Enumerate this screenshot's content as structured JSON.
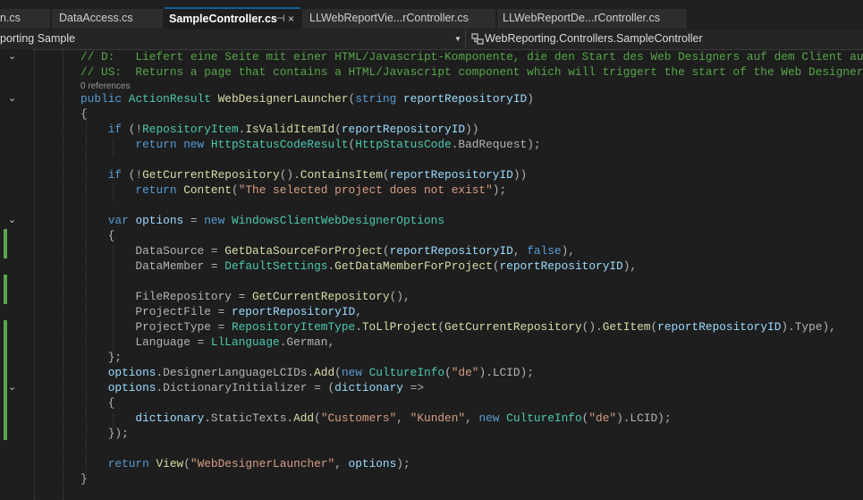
{
  "tabs": [
    {
      "label": "n.cs"
    },
    {
      "label": "DataAccess.cs"
    },
    {
      "label": "SampleController.cs",
      "active": true,
      "pin": "⊣",
      "close": "×"
    },
    {
      "label": "LLWebReportVie...rController.cs"
    },
    {
      "label": "LLWebReportDe...rController.cs"
    }
  ],
  "navbar": {
    "project": "porting Sample",
    "member": "WebReporting.Controllers.SampleController"
  },
  "code": {
    "l1": [
      [
        "cm",
        "// D:   Liefert eine Seite mit einer HTML/Javascript-Komponente, die den Start des Web Designers auf dem Client aus"
      ]
    ],
    "l2": [
      [
        "cm",
        "// US:  Returns a page that contains a HTML/Javascript component which will triggert the start of the Web Designer"
      ]
    ],
    "codelens": "0 references",
    "l3": [
      [
        "kw",
        "public "
      ],
      [
        "ty",
        "ActionResult "
      ],
      [
        "fn",
        "WebDesignerLauncher"
      ],
      [
        "pu",
        "("
      ],
      [
        "kw",
        "string "
      ],
      [
        "pr",
        "reportRepositoryID"
      ],
      [
        "pu",
        ")"
      ]
    ],
    "l4": [
      [
        "pu",
        "{"
      ]
    ],
    "l5": [
      [
        "kw",
        "    if "
      ],
      [
        "pu",
        "(!"
      ],
      [
        "ty",
        "RepositoryItem"
      ],
      [
        "pu",
        "."
      ],
      [
        "fn",
        "IsValidItemId"
      ],
      [
        "pu",
        "("
      ],
      [
        "pr",
        "reportRepositoryID"
      ],
      [
        "pu",
        "))"
      ]
    ],
    "l6": [
      [
        "kw",
        "        return new "
      ],
      [
        "ty",
        "HttpStatusCodeResult"
      ],
      [
        "pu",
        "("
      ],
      [
        "ty",
        "HttpStatusCode"
      ],
      [
        "pu",
        "."
      ],
      [
        "pu",
        "BadRequest);"
      ]
    ],
    "l7": [
      [
        "kw",
        "    if "
      ],
      [
        "pu",
        "(!"
      ],
      [
        "fn",
        "GetCurrentRepository"
      ],
      [
        "pu",
        "()."
      ],
      [
        "fn",
        "ContainsItem"
      ],
      [
        "pu",
        "("
      ],
      [
        "pr",
        "reportRepositoryID"
      ],
      [
        "pu",
        "))"
      ]
    ],
    "l8": [
      [
        "kw",
        "        return "
      ],
      [
        "fn",
        "Content"
      ],
      [
        "pu",
        "("
      ],
      [
        "st",
        "\"The selected project does not exist\""
      ],
      [
        "pu",
        ");"
      ]
    ],
    "l9": [
      [
        "kw",
        "    var "
      ],
      [
        "pr",
        "options "
      ],
      [
        "pu",
        "= "
      ],
      [
        "kw",
        "new "
      ],
      [
        "ty",
        "WindowsClientWebDesignerOptions"
      ]
    ],
    "l10": [
      [
        "pu",
        "    {"
      ]
    ],
    "l11": [
      [
        "pu",
        "        DataSource = "
      ],
      [
        "fn",
        "GetDataSourceForProject"
      ],
      [
        "pu",
        "("
      ],
      [
        "pr",
        "reportRepositoryID"
      ],
      [
        "pu",
        ", "
      ],
      [
        "kw",
        "false"
      ],
      [
        "pu",
        "),"
      ]
    ],
    "l12": [
      [
        "pu",
        "        DataMember = "
      ],
      [
        "ty",
        "DefaultSettings"
      ],
      [
        "pu",
        "."
      ],
      [
        "fn",
        "GetDataMemberForProject"
      ],
      [
        "pu",
        "("
      ],
      [
        "pr",
        "reportRepositoryID"
      ],
      [
        "pu",
        "),"
      ]
    ],
    "l13": [
      [
        "pu",
        "        FileRepository = "
      ],
      [
        "fn",
        "GetCurrentRepository"
      ],
      [
        "pu",
        "(),"
      ]
    ],
    "l14": [
      [
        "pu",
        "        ProjectFile = "
      ],
      [
        "pr",
        "reportRepositoryID"
      ],
      [
        "pu",
        ","
      ]
    ],
    "l15": [
      [
        "pu",
        "        ProjectType = "
      ],
      [
        "ty",
        "RepositoryItemType"
      ],
      [
        "pu",
        "."
      ],
      [
        "fn",
        "ToLlProject"
      ],
      [
        "pu",
        "("
      ],
      [
        "fn",
        "GetCurrentRepository"
      ],
      [
        "pu",
        "()."
      ],
      [
        "fn",
        "GetItem"
      ],
      [
        "pu",
        "("
      ],
      [
        "pr",
        "reportRepositoryID"
      ],
      [
        "pu",
        ").Type),"
      ]
    ],
    "l16": [
      [
        "pu",
        "        Language = "
      ],
      [
        "ty",
        "LlLanguage"
      ],
      [
        "pu",
        ".German,"
      ]
    ],
    "l17": [
      [
        "pu",
        "    };"
      ]
    ],
    "l18": [
      [
        "pr",
        "    options"
      ],
      [
        "pu",
        "."
      ],
      [
        "pu",
        "DesignerLanguageLCIDs."
      ],
      [
        "fn",
        "Add"
      ],
      [
        "pu",
        "("
      ],
      [
        "kw",
        "new "
      ],
      [
        "ty",
        "CultureInfo"
      ],
      [
        "pu",
        "("
      ],
      [
        "st",
        "\"de\""
      ],
      [
        "pu",
        ").LCID);"
      ]
    ],
    "l19": [
      [
        "pr",
        "    options"
      ],
      [
        "pu",
        "."
      ],
      [
        "pu",
        "DictionaryInitializer = ("
      ],
      [
        "pr",
        "dictionary "
      ],
      [
        "pu",
        "=>"
      ]
    ],
    "l20": [
      [
        "pu",
        "    {"
      ]
    ],
    "l21": [
      [
        "pr",
        "        dictionary"
      ],
      [
        "pu",
        "."
      ],
      [
        "pu",
        "StaticTexts."
      ],
      [
        "fn",
        "Add"
      ],
      [
        "pu",
        "("
      ],
      [
        "st",
        "\"Customers\""
      ],
      [
        "pu",
        ", "
      ],
      [
        "st",
        "\"Kunden\""
      ],
      [
        "pu",
        ", "
      ],
      [
        "kw",
        "new "
      ],
      [
        "ty",
        "CultureInfo"
      ],
      [
        "pu",
        "("
      ],
      [
        "st",
        "\"de\""
      ],
      [
        "pu",
        ").LCID);"
      ]
    ],
    "l22": [
      [
        "pu",
        "    });"
      ]
    ],
    "l23": [
      [
        "kw",
        "    return "
      ],
      [
        "fn",
        "View"
      ],
      [
        "pu",
        "("
      ],
      [
        "st",
        "\"WebDesignerLauncher\""
      ],
      [
        "pu",
        ", "
      ],
      [
        "pr",
        "options"
      ],
      [
        "pu",
        ");"
      ]
    ],
    "l24": [
      [
        "pu",
        "}"
      ]
    ]
  }
}
